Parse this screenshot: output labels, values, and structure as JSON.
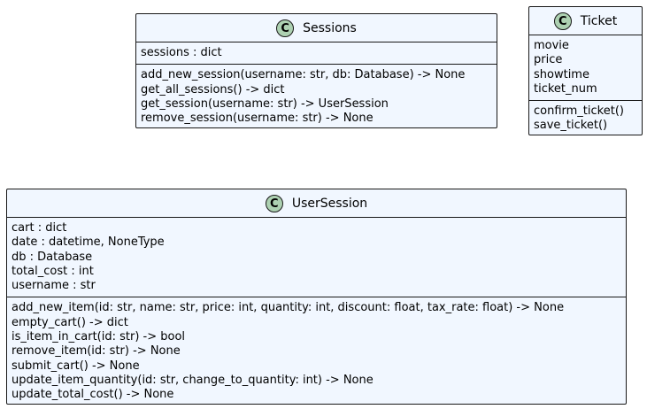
{
  "classes": {
    "sessions": {
      "stereotype_letter": "C",
      "name": "Sessions",
      "attributes": [
        "sessions : dict"
      ],
      "methods": [
        "add_new_session(username: str, db: Database) -> None",
        "get_all_sessions() -> dict",
        "get_session(username: str) -> UserSession",
        "remove_session(username: str) -> None"
      ]
    },
    "ticket": {
      "stereotype_letter": "C",
      "name": "Ticket",
      "attributes": [
        "movie",
        "price",
        "showtime",
        "ticket_num"
      ],
      "methods": [
        "confirm_ticket()",
        "save_ticket()"
      ]
    },
    "user_session": {
      "stereotype_letter": "C",
      "name": "UserSession",
      "attributes": [
        "cart : dict",
        "date : datetime, NoneType",
        "db : Database",
        "total_cost : int",
        "username : str"
      ],
      "methods": [
        "add_new_item(id: str, name: str, price: int, quantity: int, discount: float, tax_rate: float) -> None",
        "empty_cart() -> dict",
        "is_item_in_cart(id: str) -> bool",
        "remove_item(id: str) -> None",
        "submit_cart() -> None",
        "update_item_quantity(id: str, change_to_quantity: int) -> None",
        "update_total_cost() -> None"
      ]
    }
  },
  "colors": {
    "class_fill": "#f1f7ff",
    "border": "#181818",
    "icon_fill": "#add1b2"
  }
}
